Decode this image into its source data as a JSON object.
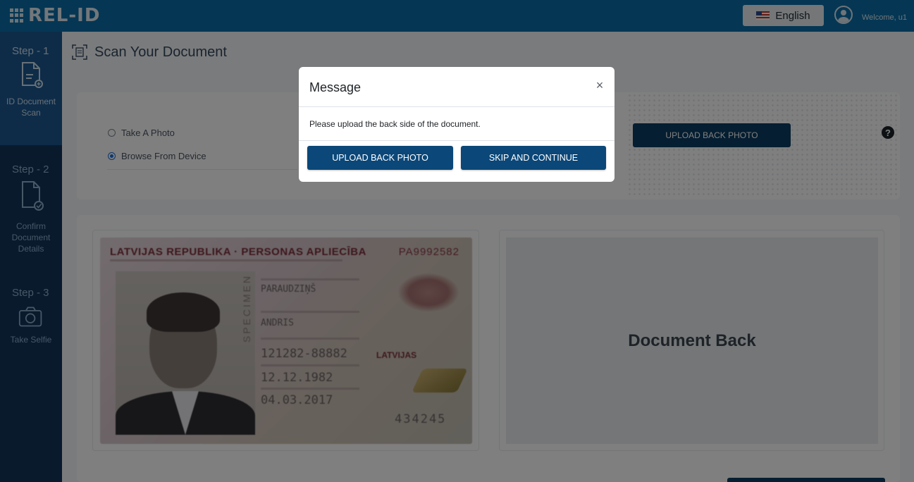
{
  "header": {
    "logo_text": "REL-ID",
    "language_label": "English",
    "welcome_text": "Welcome, u1"
  },
  "sidebar": {
    "steps": [
      {
        "step": "Step - 1",
        "label": "ID Document Scan",
        "icon": "document-scan-icon",
        "active": true
      },
      {
        "step": "Step - 2",
        "label": "Confirm Document Details",
        "icon": "document-check-icon",
        "active": false
      },
      {
        "step": "Step - 3",
        "label": "Take Selfie",
        "icon": "camera-icon",
        "active": false
      }
    ]
  },
  "main": {
    "title": "Scan Your Document",
    "options": [
      {
        "label": "Take A Photo",
        "selected": false
      },
      {
        "label": "Browse From Device",
        "selected": true
      }
    ],
    "upload_back_button": "UPLOAD BACK PHOTO",
    "document_front": {
      "header": "LATVIJAS REPUBLIKA · PERSONAS APLIECĪBA",
      "number": "PA9992582",
      "specimen": "SPECIMEN",
      "surname": "PARAUDZIŅŠ",
      "given_name": "ANDRIS",
      "personal_code": "121282-88882",
      "nationality": "LATVIJAS",
      "birth_date": "12.12.1982",
      "issue_date": "04.03.2017",
      "code": "434245"
    },
    "document_back_label": "Document Back"
  },
  "modal": {
    "title": "Message",
    "close_symbol": "×",
    "message": "Please upload the back side of the document.",
    "primary_button": "UPLOAD BACK PHOTO",
    "secondary_button": "SKIP AND CONTINUE"
  },
  "colors": {
    "topbar": "#0a6fa8",
    "sidebar": "#13355a",
    "sidebar_active": "#1c5890",
    "button": "#0b3d63"
  }
}
